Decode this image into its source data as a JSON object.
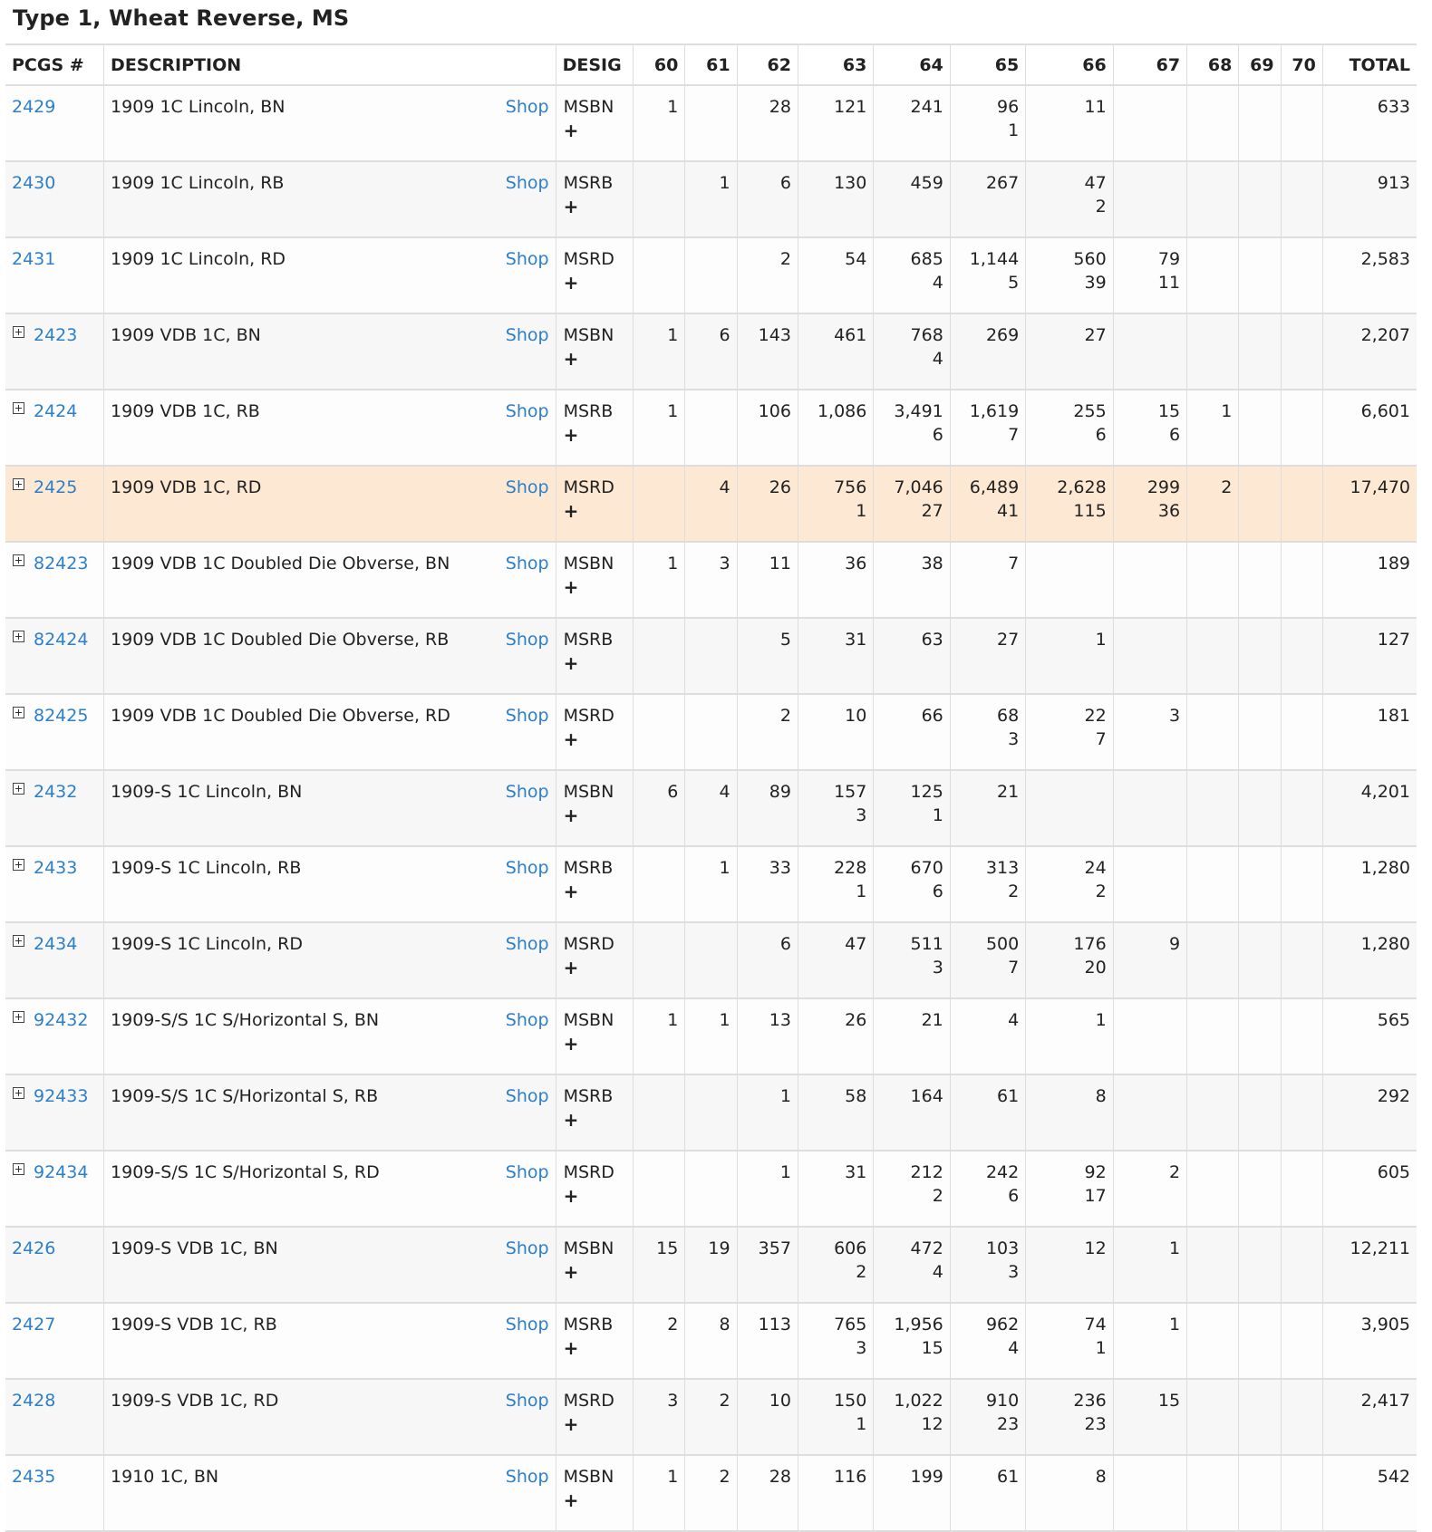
{
  "title": "Type 1, Wheat Reverse, MS",
  "columns": [
    "PCGS #",
    "DESCRIPTION",
    "DESIG",
    "60",
    "61",
    "62",
    "63",
    "64",
    "65",
    "66",
    "67",
    "68",
    "69",
    "70",
    "TOTAL"
  ],
  "shop_label": "Shop",
  "plus_label": "+",
  "rows": [
    {
      "pcgs": "2429",
      "expand": false,
      "desc": "1909 1C Lincoln, BN",
      "desig": "MSBN",
      "g60": [
        "1",
        ""
      ],
      "g61": [
        "",
        ""
      ],
      "g62": [
        "28",
        ""
      ],
      "g63": [
        "121",
        ""
      ],
      "g64": [
        "241",
        ""
      ],
      "g65": [
        "96",
        "1"
      ],
      "g66": [
        "11",
        ""
      ],
      "g67": [
        "",
        ""
      ],
      "g68": [
        "",
        ""
      ],
      "g69": [
        "",
        ""
      ],
      "g70": [
        "",
        ""
      ],
      "total": "633"
    },
    {
      "pcgs": "2430",
      "expand": false,
      "desc": "1909 1C Lincoln, RB",
      "desig": "MSRB",
      "g60": [
        "",
        ""
      ],
      "g61": [
        "1",
        ""
      ],
      "g62": [
        "6",
        ""
      ],
      "g63": [
        "130",
        ""
      ],
      "g64": [
        "459",
        ""
      ],
      "g65": [
        "267",
        ""
      ],
      "g66": [
        "47",
        "2"
      ],
      "g67": [
        "",
        ""
      ],
      "g68": [
        "",
        ""
      ],
      "g69": [
        "",
        ""
      ],
      "g70": [
        "",
        ""
      ],
      "total": "913"
    },
    {
      "pcgs": "2431",
      "expand": false,
      "desc": "1909 1C Lincoln, RD",
      "desig": "MSRD",
      "g60": [
        "",
        ""
      ],
      "g61": [
        "",
        ""
      ],
      "g62": [
        "2",
        ""
      ],
      "g63": [
        "54",
        ""
      ],
      "g64": [
        "685",
        "4"
      ],
      "g65": [
        "1,144",
        "5"
      ],
      "g66": [
        "560",
        "39"
      ],
      "g67": [
        "79",
        "11"
      ],
      "g68": [
        "",
        ""
      ],
      "g69": [
        "",
        ""
      ],
      "g70": [
        "",
        ""
      ],
      "total": "2,583"
    },
    {
      "pcgs": "2423",
      "expand": true,
      "desc": "1909 VDB 1C, BN",
      "desig": "MSBN",
      "g60": [
        "1",
        ""
      ],
      "g61": [
        "6",
        ""
      ],
      "g62": [
        "143",
        ""
      ],
      "g63": [
        "461",
        ""
      ],
      "g64": [
        "768",
        "4"
      ],
      "g65": [
        "269",
        ""
      ],
      "g66": [
        "27",
        ""
      ],
      "g67": [
        "",
        ""
      ],
      "g68": [
        "",
        ""
      ],
      "g69": [
        "",
        ""
      ],
      "g70": [
        "",
        ""
      ],
      "total": "2,207"
    },
    {
      "pcgs": "2424",
      "expand": true,
      "desc": "1909 VDB 1C, RB",
      "desig": "MSRB",
      "g60": [
        "1",
        ""
      ],
      "g61": [
        "",
        ""
      ],
      "g62": [
        "106",
        ""
      ],
      "g63": [
        "1,086",
        ""
      ],
      "g64": [
        "3,491",
        "6"
      ],
      "g65": [
        "1,619",
        "7"
      ],
      "g66": [
        "255",
        "6"
      ],
      "g67": [
        "15",
        "6"
      ],
      "g68": [
        "1",
        ""
      ],
      "g69": [
        "",
        ""
      ],
      "g70": [
        "",
        ""
      ],
      "total": "6,601"
    },
    {
      "pcgs": "2425",
      "expand": true,
      "highlight": true,
      "desc": "1909 VDB 1C, RD",
      "desig": "MSRD",
      "g60": [
        "",
        ""
      ],
      "g61": [
        "4",
        ""
      ],
      "g62": [
        "26",
        ""
      ],
      "g63": [
        "756",
        "1"
      ],
      "g64": [
        "7,046",
        "27"
      ],
      "g65": [
        "6,489",
        "41"
      ],
      "g66": [
        "2,628",
        "115"
      ],
      "g67": [
        "299",
        "36"
      ],
      "g68": [
        "2",
        ""
      ],
      "g69": [
        "",
        ""
      ],
      "g70": [
        "",
        ""
      ],
      "total": "17,470"
    },
    {
      "pcgs": "82423",
      "expand": true,
      "desc": "1909 VDB 1C Doubled Die Obverse, BN",
      "desig": "MSBN",
      "g60": [
        "1",
        ""
      ],
      "g61": [
        "3",
        ""
      ],
      "g62": [
        "11",
        ""
      ],
      "g63": [
        "36",
        ""
      ],
      "g64": [
        "38",
        ""
      ],
      "g65": [
        "7",
        ""
      ],
      "g66": [
        "",
        ""
      ],
      "g67": [
        "",
        ""
      ],
      "g68": [
        "",
        ""
      ],
      "g69": [
        "",
        ""
      ],
      "g70": [
        "",
        ""
      ],
      "total": "189"
    },
    {
      "pcgs": "82424",
      "expand": true,
      "desc": "1909 VDB 1C Doubled Die Obverse, RB",
      "desig": "MSRB",
      "g60": [
        "",
        ""
      ],
      "g61": [
        "",
        ""
      ],
      "g62": [
        "5",
        ""
      ],
      "g63": [
        "31",
        ""
      ],
      "g64": [
        "63",
        ""
      ],
      "g65": [
        "27",
        ""
      ],
      "g66": [
        "1",
        ""
      ],
      "g67": [
        "",
        ""
      ],
      "g68": [
        "",
        ""
      ],
      "g69": [
        "",
        ""
      ],
      "g70": [
        "",
        ""
      ],
      "total": "127"
    },
    {
      "pcgs": "82425",
      "expand": true,
      "desc": "1909 VDB 1C Doubled Die Obverse, RD",
      "desig": "MSRD",
      "g60": [
        "",
        ""
      ],
      "g61": [
        "",
        ""
      ],
      "g62": [
        "2",
        ""
      ],
      "g63": [
        "10",
        ""
      ],
      "g64": [
        "66",
        ""
      ],
      "g65": [
        "68",
        "3"
      ],
      "g66": [
        "22",
        "7"
      ],
      "g67": [
        "3",
        ""
      ],
      "g68": [
        "",
        ""
      ],
      "g69": [
        "",
        ""
      ],
      "g70": [
        "",
        ""
      ],
      "total": "181"
    },
    {
      "pcgs": "2432",
      "expand": true,
      "desc": "1909-S 1C Lincoln, BN",
      "desig": "MSBN",
      "g60": [
        "6",
        ""
      ],
      "g61": [
        "4",
        ""
      ],
      "g62": [
        "89",
        ""
      ],
      "g63": [
        "157",
        "3"
      ],
      "g64": [
        "125",
        "1"
      ],
      "g65": [
        "21",
        ""
      ],
      "g66": [
        "",
        ""
      ],
      "g67": [
        "",
        ""
      ],
      "g68": [
        "",
        ""
      ],
      "g69": [
        "",
        ""
      ],
      "g70": [
        "",
        ""
      ],
      "total": "4,201"
    },
    {
      "pcgs": "2433",
      "expand": true,
      "desc": "1909-S 1C Lincoln, RB",
      "desig": "MSRB",
      "g60": [
        "",
        ""
      ],
      "g61": [
        "1",
        ""
      ],
      "g62": [
        "33",
        ""
      ],
      "g63": [
        "228",
        "1"
      ],
      "g64": [
        "670",
        "6"
      ],
      "g65": [
        "313",
        "2"
      ],
      "g66": [
        "24",
        "2"
      ],
      "g67": [
        "",
        ""
      ],
      "g68": [
        "",
        ""
      ],
      "g69": [
        "",
        ""
      ],
      "g70": [
        "",
        ""
      ],
      "total": "1,280"
    },
    {
      "pcgs": "2434",
      "expand": true,
      "desc": "1909-S 1C Lincoln, RD",
      "desig": "MSRD",
      "g60": [
        "",
        ""
      ],
      "g61": [
        "",
        ""
      ],
      "g62": [
        "6",
        ""
      ],
      "g63": [
        "47",
        ""
      ],
      "g64": [
        "511",
        "3"
      ],
      "g65": [
        "500",
        "7"
      ],
      "g66": [
        "176",
        "20"
      ],
      "g67": [
        "9",
        ""
      ],
      "g68": [
        "",
        ""
      ],
      "g69": [
        "",
        ""
      ],
      "g70": [
        "",
        ""
      ],
      "total": "1,280"
    },
    {
      "pcgs": "92432",
      "expand": true,
      "desc": "1909-S/S 1C S/Horizontal S, BN",
      "desig": "MSBN",
      "g60": [
        "1",
        ""
      ],
      "g61": [
        "1",
        ""
      ],
      "g62": [
        "13",
        ""
      ],
      "g63": [
        "26",
        ""
      ],
      "g64": [
        "21",
        ""
      ],
      "g65": [
        "4",
        ""
      ],
      "g66": [
        "1",
        ""
      ],
      "g67": [
        "",
        ""
      ],
      "g68": [
        "",
        ""
      ],
      "g69": [
        "",
        ""
      ],
      "g70": [
        "",
        ""
      ],
      "total": "565"
    },
    {
      "pcgs": "92433",
      "expand": true,
      "desc": "1909-S/S 1C S/Horizontal S, RB",
      "desig": "MSRB",
      "g60": [
        "",
        ""
      ],
      "g61": [
        "",
        ""
      ],
      "g62": [
        "1",
        ""
      ],
      "g63": [
        "58",
        ""
      ],
      "g64": [
        "164",
        ""
      ],
      "g65": [
        "61",
        ""
      ],
      "g66": [
        "8",
        ""
      ],
      "g67": [
        "",
        ""
      ],
      "g68": [
        "",
        ""
      ],
      "g69": [
        "",
        ""
      ],
      "g70": [
        "",
        ""
      ],
      "total": "292"
    },
    {
      "pcgs": "92434",
      "expand": true,
      "desc": "1909-S/S 1C S/Horizontal S, RD",
      "desig": "MSRD",
      "g60": [
        "",
        ""
      ],
      "g61": [
        "",
        ""
      ],
      "g62": [
        "1",
        ""
      ],
      "g63": [
        "31",
        ""
      ],
      "g64": [
        "212",
        "2"
      ],
      "g65": [
        "242",
        "6"
      ],
      "g66": [
        "92",
        "17"
      ],
      "g67": [
        "2",
        ""
      ],
      "g68": [
        "",
        ""
      ],
      "g69": [
        "",
        ""
      ],
      "g70": [
        "",
        ""
      ],
      "total": "605"
    },
    {
      "pcgs": "2426",
      "expand": false,
      "desc": "1909-S VDB 1C, BN",
      "desig": "MSBN",
      "g60": [
        "15",
        ""
      ],
      "g61": [
        "19",
        ""
      ],
      "g62": [
        "357",
        ""
      ],
      "g63": [
        "606",
        "2"
      ],
      "g64": [
        "472",
        "4"
      ],
      "g65": [
        "103",
        "3"
      ],
      "g66": [
        "12",
        ""
      ],
      "g67": [
        "1",
        ""
      ],
      "g68": [
        "",
        ""
      ],
      "g69": [
        "",
        ""
      ],
      "g70": [
        "",
        ""
      ],
      "total": "12,211"
    },
    {
      "pcgs": "2427",
      "expand": false,
      "desc": "1909-S VDB 1C, RB",
      "desig": "MSRB",
      "g60": [
        "2",
        ""
      ],
      "g61": [
        "8",
        ""
      ],
      "g62": [
        "113",
        ""
      ],
      "g63": [
        "765",
        "3"
      ],
      "g64": [
        "1,956",
        "15"
      ],
      "g65": [
        "962",
        "4"
      ],
      "g66": [
        "74",
        "1"
      ],
      "g67": [
        "1",
        ""
      ],
      "g68": [
        "",
        ""
      ],
      "g69": [
        "",
        ""
      ],
      "g70": [
        "",
        ""
      ],
      "total": "3,905"
    },
    {
      "pcgs": "2428",
      "expand": false,
      "desc": "1909-S VDB 1C, RD",
      "desig": "MSRD",
      "g60": [
        "3",
        ""
      ],
      "g61": [
        "2",
        ""
      ],
      "g62": [
        "10",
        ""
      ],
      "g63": [
        "150",
        "1"
      ],
      "g64": [
        "1,022",
        "12"
      ],
      "g65": [
        "910",
        "23"
      ],
      "g66": [
        "236",
        "23"
      ],
      "g67": [
        "15",
        ""
      ],
      "g68": [
        "",
        ""
      ],
      "g69": [
        "",
        ""
      ],
      "g70": [
        "",
        ""
      ],
      "total": "2,417"
    },
    {
      "pcgs": "2435",
      "expand": false,
      "desc": "1910 1C, BN",
      "desig": "MSBN",
      "g60": [
        "1",
        ""
      ],
      "g61": [
        "2",
        ""
      ],
      "g62": [
        "28",
        ""
      ],
      "g63": [
        "116",
        ""
      ],
      "g64": [
        "199",
        ""
      ],
      "g65": [
        "61",
        ""
      ],
      "g66": [
        "8",
        ""
      ],
      "g67": [
        "",
        ""
      ],
      "g68": [
        "",
        ""
      ],
      "g69": [
        "",
        ""
      ],
      "g70": [
        "",
        ""
      ],
      "total": "542"
    }
  ]
}
